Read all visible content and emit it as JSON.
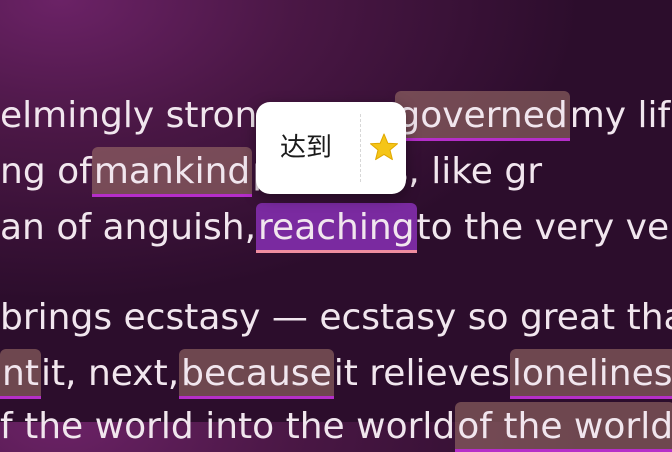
{
  "reader": {
    "lines": [
      [
        {
          "text": "elmingly stron",
          "highlight": null
        },
        {
          "text": "governed",
          "highlight": "saved"
        },
        {
          "text": " my lif",
          "highlight": null
        }
      ],
      [
        {
          "text": "ng of ",
          "highlight": null
        },
        {
          "text": "mankind",
          "highlight": "saved"
        },
        {
          "text": "passions, like gr",
          "highlight": null
        }
      ],
      [
        {
          "text": "an of anguish, ",
          "highlight": null
        },
        {
          "text": "reaching",
          "highlight": "active"
        },
        {
          "text": " to the very ve",
          "highlight": null
        }
      ],
      [
        {
          "text": " brings ecstasy — ecstasy so great tha",
          "highlight": null
        }
      ],
      [
        {
          "text": "nt",
          "highlight": "saved"
        },
        {
          "text": " it, next, ",
          "highlight": null
        },
        {
          "text": "because",
          "highlight": "saved"
        },
        {
          "text": " it relieves ",
          "highlight": null
        },
        {
          "text": "loneliness",
          "highlight": "saved"
        }
      ],
      [
        {
          "text": "f the world into the world ",
          "highlight": null
        },
        {
          "text": "of the world",
          "highlight": "saved"
        }
      ]
    ]
  },
  "popup": {
    "translation": "达到",
    "star_icon": "star-icon",
    "star_color": "#f5c518"
  },
  "colors": {
    "highlight_saved": "#a5786e",
    "highlight_active": "#7a2aa0",
    "underline_saved": "#b52ec9",
    "underline_active": "#f08da0"
  }
}
